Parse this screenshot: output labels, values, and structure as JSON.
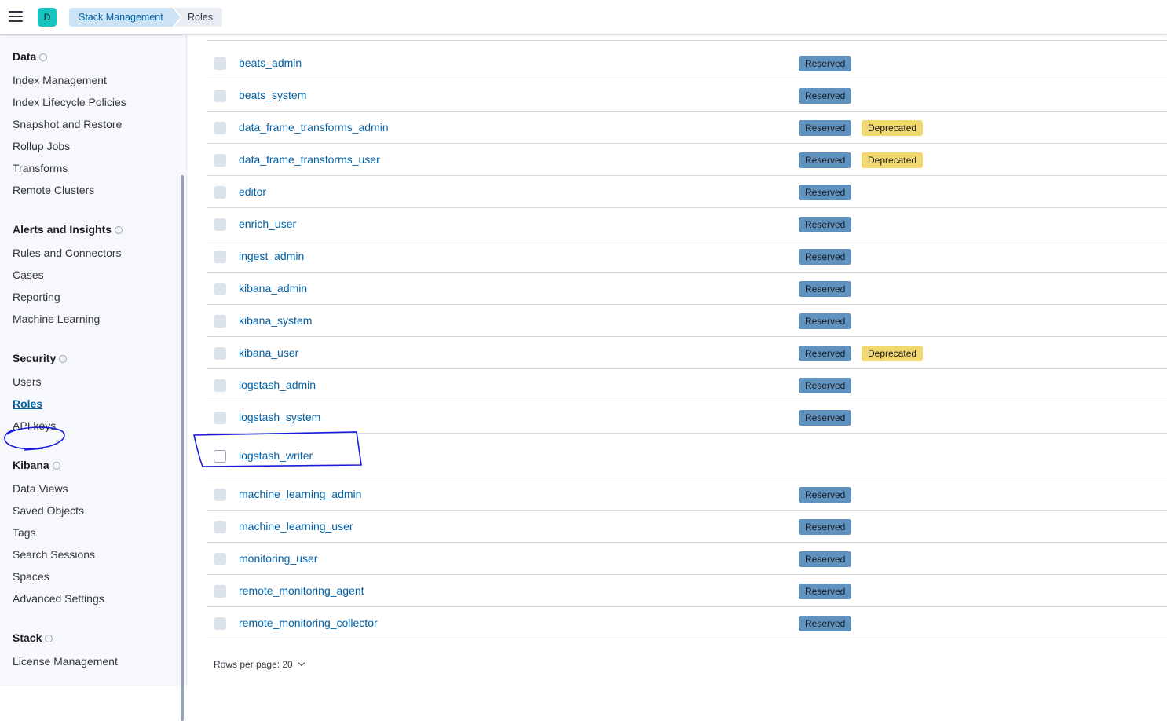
{
  "header": {
    "avatar_letter": "D",
    "breadcrumbs": [
      "Stack Management",
      "Roles"
    ]
  },
  "sidebar": {
    "sections": [
      {
        "title": "Data",
        "items": [
          "Index Management",
          "Index Lifecycle Policies",
          "Snapshot and Restore",
          "Rollup Jobs",
          "Transforms",
          "Remote Clusters"
        ]
      },
      {
        "title": "Alerts and Insights",
        "items": [
          "Rules and Connectors",
          "Cases",
          "Reporting",
          "Machine Learning"
        ]
      },
      {
        "title": "Security",
        "items": [
          "Users",
          "Roles",
          "API keys"
        ]
      },
      {
        "title": "Kibana",
        "items": [
          "Data Views",
          "Saved Objects",
          "Tags",
          "Search Sessions",
          "Spaces",
          "Advanced Settings"
        ]
      },
      {
        "title": "Stack",
        "items": [
          "License Management"
        ]
      }
    ],
    "active_item": "Roles"
  },
  "roles": [
    {
      "name": "beats_admin",
      "reserved": "Reserved",
      "deprecated": ""
    },
    {
      "name": "beats_system",
      "reserved": "Reserved",
      "deprecated": ""
    },
    {
      "name": "data_frame_transforms_admin",
      "reserved": "Reserved",
      "deprecated": "Deprecated"
    },
    {
      "name": "data_frame_transforms_user",
      "reserved": "Reserved",
      "deprecated": "Deprecated"
    },
    {
      "name": "editor",
      "reserved": "Reserved",
      "deprecated": ""
    },
    {
      "name": "enrich_user",
      "reserved": "Reserved",
      "deprecated": ""
    },
    {
      "name": "ingest_admin",
      "reserved": "Reserved",
      "deprecated": ""
    },
    {
      "name": "kibana_admin",
      "reserved": "Reserved",
      "deprecated": ""
    },
    {
      "name": "kibana_system",
      "reserved": "Reserved",
      "deprecated": ""
    },
    {
      "name": "kibana_user",
      "reserved": "Reserved",
      "deprecated": "Deprecated"
    },
    {
      "name": "logstash_admin",
      "reserved": "Reserved",
      "deprecated": ""
    },
    {
      "name": "logstash_system",
      "reserved": "Reserved",
      "deprecated": ""
    },
    {
      "name": "logstash_writer",
      "reserved": "",
      "deprecated": ""
    },
    {
      "name": "machine_learning_admin",
      "reserved": "Reserved",
      "deprecated": ""
    },
    {
      "name": "machine_learning_user",
      "reserved": "Reserved",
      "deprecated": ""
    },
    {
      "name": "monitoring_user",
      "reserved": "Reserved",
      "deprecated": ""
    },
    {
      "name": "remote_monitoring_agent",
      "reserved": "Reserved",
      "deprecated": ""
    },
    {
      "name": "remote_monitoring_collector",
      "reserved": "Reserved",
      "deprecated": ""
    }
  ],
  "pagination": {
    "rows_per_page": "Rows per page: 20"
  },
  "colors": {
    "reserved_badge": "#6092c0",
    "deprecated_badge": "#f1d86f",
    "link": "#0061a6",
    "annotation": "#1a1adb"
  }
}
